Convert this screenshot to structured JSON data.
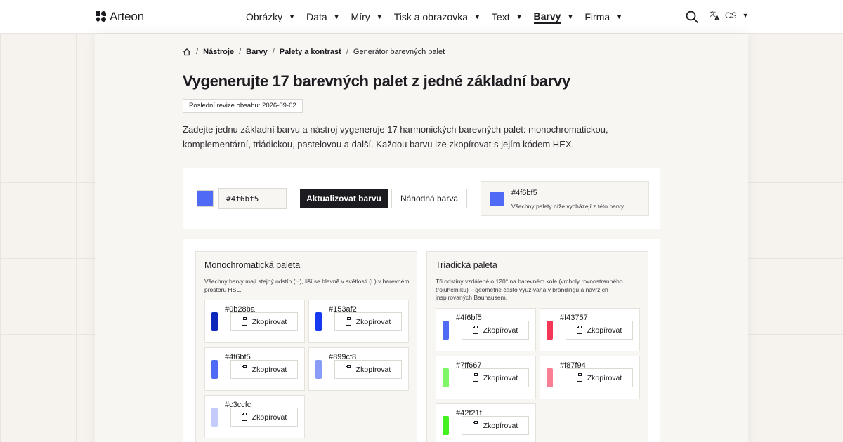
{
  "header": {
    "brand": "Arteon",
    "nav": [
      {
        "label": "Obrázky",
        "active": false
      },
      {
        "label": "Data",
        "active": false
      },
      {
        "label": "Míry",
        "active": false
      },
      {
        "label": "Tisk a obrazovka",
        "active": false
      },
      {
        "label": "Text",
        "active": false
      },
      {
        "label": "Barvy",
        "active": true
      },
      {
        "label": "Firma",
        "active": false
      }
    ],
    "language": "CS"
  },
  "breadcrumb": {
    "items": [
      "Nástroje",
      "Barvy",
      "Palety a kontrast"
    ],
    "current": "Generátor barevných palet",
    "separator": "/"
  },
  "page": {
    "title": "Vygenerujte 17 barevných palet z jedné základní barvy",
    "revision": "Poslední revize obsahu: 2026-09-02",
    "intro": "Zadejte jednu základní barvu a nástroj vygeneruje 17 harmonických barevných palet: monochromatickou, komplementární, triádickou, pastelovou a další. Každou barvu lze zkopírovat s jejím kódem HEX."
  },
  "picker": {
    "color": "#4f6bf5",
    "hex_value": "#4f6bf5",
    "update_label": "Aktualizovat barvu",
    "random_label": "Náhodná barva",
    "current_hex": "#4f6bf5",
    "current_note": "Všechny palety níže vycházejí z této barvy."
  },
  "copy_label": "Zkopírovat",
  "palettes": [
    {
      "title": "Monochromatická paleta",
      "description": "Všechny barvy mají stejný odstín (H), liší se hlavně v světlosti (L) v barevném prostoru HSL.",
      "colors": [
        "#0b28ba",
        "#153af2",
        "#4f6bf5",
        "#899cf8",
        "#c3ccfc"
      ]
    },
    {
      "title": "Triadická paleta",
      "description": "Tři odstíny vzdálené o 120° na barevném kole (vrcholy rovnostranného trojúhelníku) – geometrie často využívaná v brandingu a návrzích inspirovaných Bauhausem.",
      "colors": [
        "#4f6bf5",
        "#f43757",
        "#7ff667",
        "#f87f94",
        "#42f21f"
      ]
    }
  ]
}
